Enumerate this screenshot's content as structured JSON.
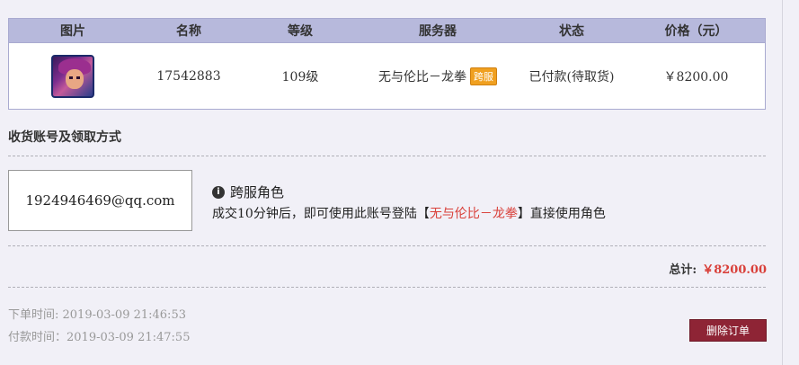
{
  "table": {
    "headers": [
      "图片",
      "名称",
      "等级",
      "服务器",
      "状态",
      "价格（元）"
    ],
    "row": {
      "avatar_icon": "game-character-avatar-icon",
      "name": "17542883",
      "level": "109级",
      "server": "无与伦比－龙拳",
      "server_badge": "跨服",
      "status": "已付款(待取货)",
      "price": "￥8200.00"
    }
  },
  "delivery": {
    "section_title": "收货账号及领取方式",
    "account": "1924946469@qq.com",
    "info_icon": "info-icon",
    "info_title": "跨服角色",
    "info_desc_prefix": "成交10分钟后，即可使用此账号登陆【",
    "info_desc_server": "无与伦比－龙拳",
    "info_desc_suffix": "】直接使用角色"
  },
  "summary": {
    "total_label": "总计:",
    "total_amount": "￥8200.00"
  },
  "times": {
    "order_time": "下单时间: 2019-03-09 21:46:53",
    "pay_time": "付款时间：2019-03-09 21:47:55"
  },
  "actions": {
    "delete_label": "删除订单"
  },
  "colors": {
    "header_bg": "#b7b9dc",
    "accent_red": "#d9403a",
    "button_bg": "#8e2435",
    "badge_bg": "#f0a020"
  }
}
